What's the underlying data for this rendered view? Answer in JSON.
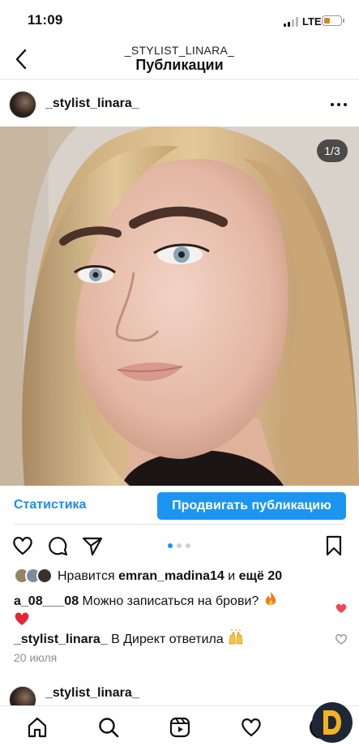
{
  "status_bar": {
    "time": "11:09",
    "network": "LTE"
  },
  "header": {
    "account": "_STYLIST_LINARA_",
    "title": "Публикации"
  },
  "post": {
    "username": "_stylist_linara_",
    "photo_counter": "1/3",
    "carousel": {
      "slides": 3,
      "current": 1
    }
  },
  "insights": {
    "stats_label": "Статистика",
    "promote_label": "Продвигать публикацию"
  },
  "likes": {
    "prefix": "Нравится",
    "user": "emran_madina14",
    "and": "и",
    "others": "ещё 20"
  },
  "comments": [
    {
      "user": "a_08___08",
      "text": "Можно записаться на брови?"
    },
    {
      "user": "_stylist_linara_",
      "text": "В Директ ответила"
    }
  ],
  "post_date": "20 июля",
  "next_post": {
    "username": "_stylist_linara_"
  },
  "colors": {
    "accent": "#1c95f1",
    "like_red": "#ed4956"
  }
}
